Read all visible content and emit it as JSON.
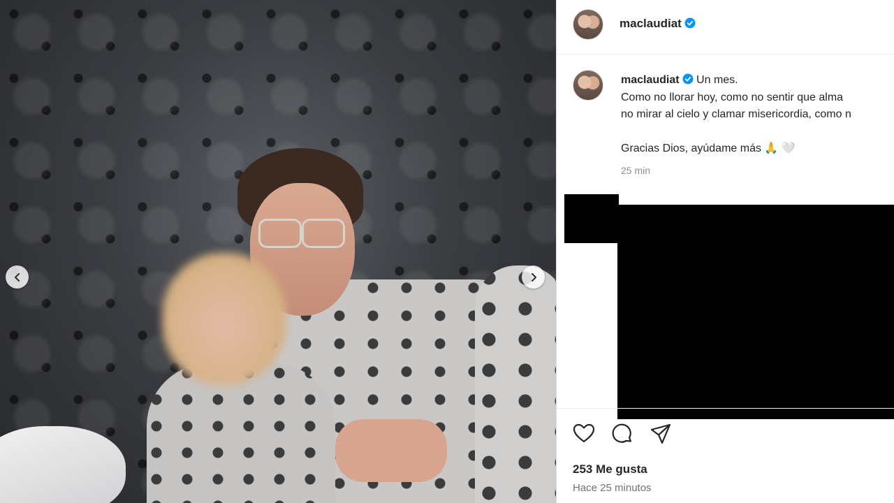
{
  "post": {
    "username": "maclaudiat",
    "verified": true,
    "image_description_icons": [
      "chevron-left-icon",
      "chevron-right-icon"
    ]
  },
  "header": {
    "username": "maclaudiat"
  },
  "caption": {
    "username": "maclaudiat",
    "line1": "Un mes.",
    "line2": "Como no llorar hoy, como no sentir que alma",
    "line3": "no mirar al cielo y clamar misericordia, como n",
    "line4": "Gracias Dios, ayúdame más 🙏 🤍",
    "time": "25 min"
  },
  "actions": {
    "icons": [
      "heart-icon",
      "comment-icon",
      "share-icon"
    ]
  },
  "footer": {
    "likes": "253 Me gusta",
    "time": "Hace 25 minutos"
  },
  "colors": {
    "verified": "#0095f6",
    "text": "#262626",
    "muted": "#8e8e8e"
  }
}
